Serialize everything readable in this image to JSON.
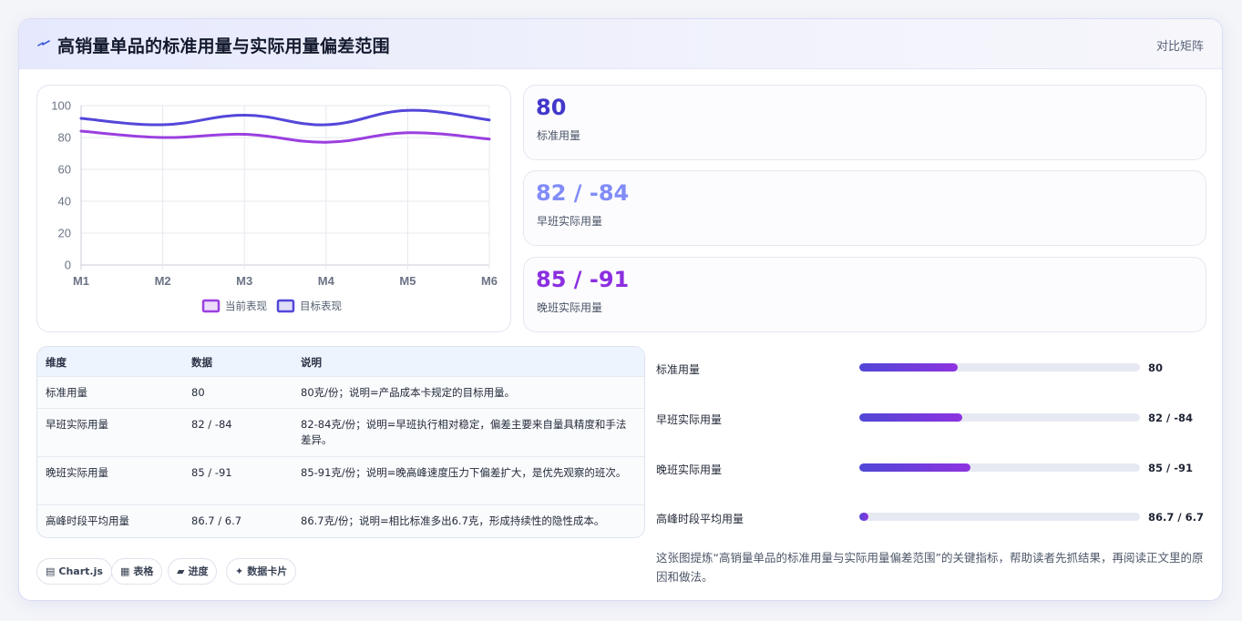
{
  "header": {
    "icon": "lightning-icon",
    "title": "高销量单品的标准用量与实际用量偏差范围",
    "subtitle": "对比矩阵"
  },
  "chart_data": {
    "type": "line",
    "categories": [
      "M1",
      "M2",
      "M3",
      "M4",
      "M5",
      "M6"
    ],
    "series": [
      {
        "name": "当前表现",
        "values": [
          84,
          80,
          82,
          77,
          83,
          79
        ],
        "color": "#9a3fe0"
      },
      {
        "name": "目标表现",
        "values": [
          92,
          88,
          94,
          88,
          97,
          91
        ],
        "color": "#5447d9"
      }
    ],
    "ylim": [
      0,
      100
    ],
    "yticks": [
      "0",
      "20",
      "40",
      "60",
      "80",
      "100"
    ],
    "grid": true,
    "legend": "bottom",
    "xlabel": "",
    "ylabel": ""
  },
  "metrics": [
    {
      "value": "80",
      "label": "标准用量",
      "color": "#4338ca"
    },
    {
      "value": "82 / -84",
      "label": "早班实际用量",
      "color": "#818cf8"
    },
    {
      "value": "85 / -91",
      "label": "晚班实际用量",
      "color": "#8b2fe0"
    }
  ],
  "table": {
    "headers": [
      "维度",
      "数据",
      "说明"
    ],
    "rows": [
      [
        "标准用量",
        "80",
        "80克/份；说明=产品成本卡规定的目标用量。"
      ],
      [
        "早班实际用量",
        "82 / -84",
        "82-84克/份；说明=早班执行相对稳定，偏差主要来自量具精度和手法差异。"
      ],
      [
        "晚班实际用量",
        "85 / -91",
        "85-91克/份；说明=晚高峰速度压力下偏差扩大，是优先观察的班次。"
      ],
      [
        "高峰时段平均用量",
        "86.7 / 6.7",
        "86.7克/份；说明=相比标准多出6.7克，形成持续性的隐性成本。"
      ]
    ]
  },
  "progress": [
    {
      "label": "标准用量",
      "value": "80",
      "fraction": 0.35
    },
    {
      "label": "早班实际用量",
      "value": "82 / -84",
      "fraction": 0.366
    },
    {
      "label": "晚班实际用量",
      "value": "85 / -91",
      "fraction": 0.395
    },
    {
      "label": "高峰时段平均用量",
      "value": "86.7 / 6.7",
      "fraction": 0.033
    }
  ],
  "note": "这张图提炼“高销量单品的标准用量与实际用量偏差范围”的关键指标，帮助读者先抓结果，再阅读正文里的原因和做法。",
  "chips": [
    {
      "icon": "chart-icon",
      "glyph": "▤",
      "label": "Chart.js"
    },
    {
      "icon": "table-icon",
      "glyph": "▦",
      "label": "表格"
    },
    {
      "icon": "progress-icon",
      "glyph": "▰",
      "label": "进度"
    },
    {
      "icon": "sparkle-icon",
      "glyph": "✦",
      "label": "数据卡片"
    }
  ]
}
